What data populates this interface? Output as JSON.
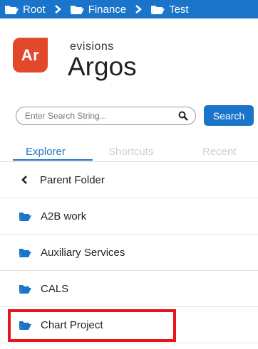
{
  "breadcrumb": {
    "items": [
      {
        "label": "Root"
      },
      {
        "label": "Finance"
      },
      {
        "label": "Test"
      }
    ]
  },
  "brand": {
    "logo_text": "Ar",
    "company": "evisions",
    "product": "Argos"
  },
  "search": {
    "placeholder": "Enter Search String...",
    "button_label": "Search"
  },
  "tabs": [
    {
      "label": "Explorer",
      "active": true
    },
    {
      "label": "Shortcuts",
      "active": false
    },
    {
      "label": "Recent",
      "active": false
    }
  ],
  "list": {
    "parent_label": "Parent Folder",
    "folders": [
      {
        "label": "A2B work"
      },
      {
        "label": "Auxiliary Services"
      },
      {
        "label": "CALS"
      },
      {
        "label": "Chart Project",
        "highlighted": true
      }
    ]
  },
  "colors": {
    "accent": "#1a74c9",
    "logo": "#e2492b",
    "highlight_border": "#e8141c"
  }
}
